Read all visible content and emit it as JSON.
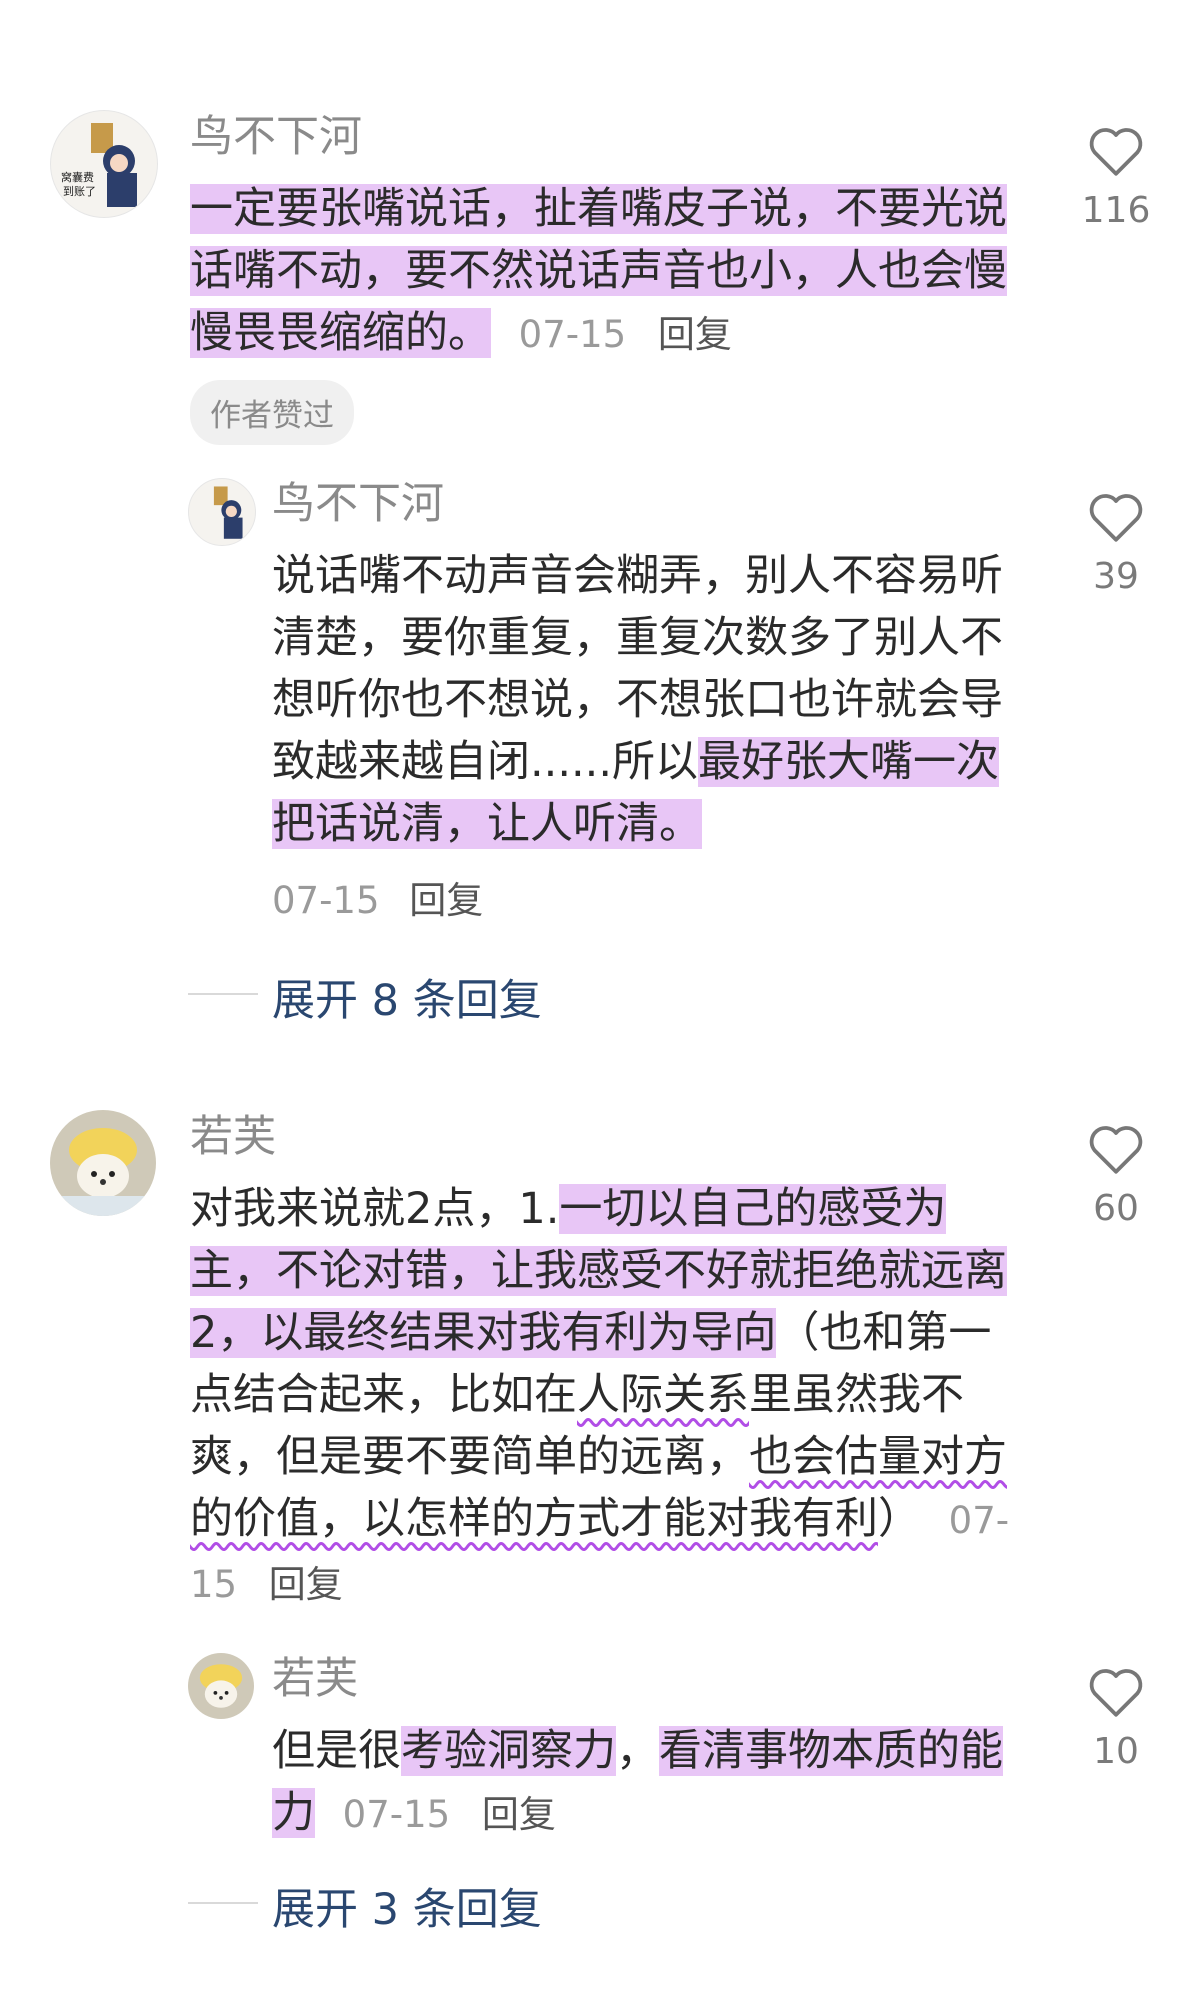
{
  "comments": [
    {
      "username": "鸟不下河",
      "text_parts": [
        {
          "text": "一定要张嘴说话，扯着嘴皮子说，不要光说话嘴不动，要不然说话声音也小，人也会慢慢畏畏缩缩的。",
          "style": "highlight"
        }
      ],
      "date": "07-15",
      "reply_label": "回复",
      "badge": "作者赞过",
      "likes": "116",
      "replies": [
        {
          "username": "鸟不下河",
          "text_parts": [
            {
              "text": "说话嘴不动声音会糊弄，别人不容易听清楚，要你重复，重复次数多了别人不想听你也不想说，不想张口也许就会导致越来越自闭......所以",
              "style": "normal"
            },
            {
              "text": "最好张大嘴一次把话说清，让人听清。",
              "style": "highlight"
            }
          ],
          "date": "07-15",
          "reply_label": "回复",
          "likes": "39"
        }
      ],
      "expand_label": "展开 8 条回复"
    },
    {
      "username": "若芙",
      "text_parts": [
        {
          "text": "对我来说就2点，1.",
          "style": "normal"
        },
        {
          "text": "一切以自己的感受为主，不论对错，让我感受不好就拒绝就远离2，以最终结果对我有利为导向",
          "style": "highlight"
        },
        {
          "text": "（也和第一点结合起来，比如在",
          "style": "normal"
        },
        {
          "text": "人际关系",
          "style": "wavy"
        },
        {
          "text": "里虽然我不爽，但是要不要简单的远离，",
          "style": "normal"
        },
        {
          "text": "也会估量对方的价值，以怎样的方式才能对我有利",
          "style": "wavy"
        },
        {
          "text": "）",
          "style": "normal"
        }
      ],
      "date": "07-15",
      "reply_label": "回复",
      "likes": "60",
      "replies": [
        {
          "username": "若芙",
          "text_parts": [
            {
              "text": "但是很",
              "style": "normal"
            },
            {
              "text": "考验洞察力",
              "style": "highlight"
            },
            {
              "text": "，",
              "style": "normal"
            },
            {
              "text": "看清事物本质的能力",
              "style": "highlight"
            }
          ],
          "date": "07-15",
          "reply_label": "回复",
          "likes": "10"
        }
      ],
      "expand_label": "展开 3 条回复"
    }
  ],
  "icons": {
    "like": "heart-outline-icon"
  },
  "colors": {
    "highlight": "#e8c6f6",
    "wavy_underline": "#b14ee6",
    "expand_text": "#2a4770"
  }
}
